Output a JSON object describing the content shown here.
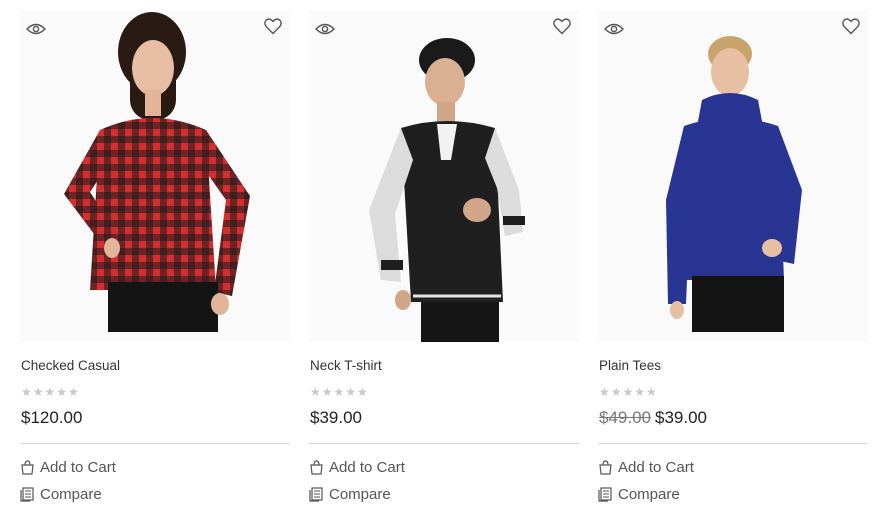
{
  "products": [
    {
      "title": "Checked Casual",
      "rating_stars": "★★★★★",
      "old_price": "",
      "price": "$120.00",
      "add_to_cart_label": "Add to Cart",
      "compare_label": "Compare",
      "icons": {
        "quickview": "eye-icon",
        "wishlist": "heart-icon",
        "cart": "shopping-bag-icon",
        "compare": "document-icon"
      }
    },
    {
      "title": "Neck T-shirt",
      "rating_stars": "★★★★★",
      "old_price": "",
      "price": "$39.00",
      "add_to_cart_label": "Add to Cart",
      "compare_label": "Compare",
      "icons": {
        "quickview": "eye-icon",
        "wishlist": "heart-icon",
        "cart": "shopping-bag-icon",
        "compare": "document-icon"
      }
    },
    {
      "title": "Plain Tees",
      "rating_stars": "★★★★★",
      "old_price": "$49.00",
      "price": "$39.00",
      "add_to_cart_label": "Add to Cart",
      "compare_label": "Compare",
      "icons": {
        "quickview": "eye-icon",
        "wishlist": "heart-icon",
        "cart": "shopping-bag-icon",
        "compare": "document-icon"
      }
    }
  ],
  "colors": {
    "text": "#333333",
    "stars": "#c8c8c8",
    "divider": "#d9d9d9",
    "red_check": "#d32f2f",
    "navy": "#283593"
  }
}
